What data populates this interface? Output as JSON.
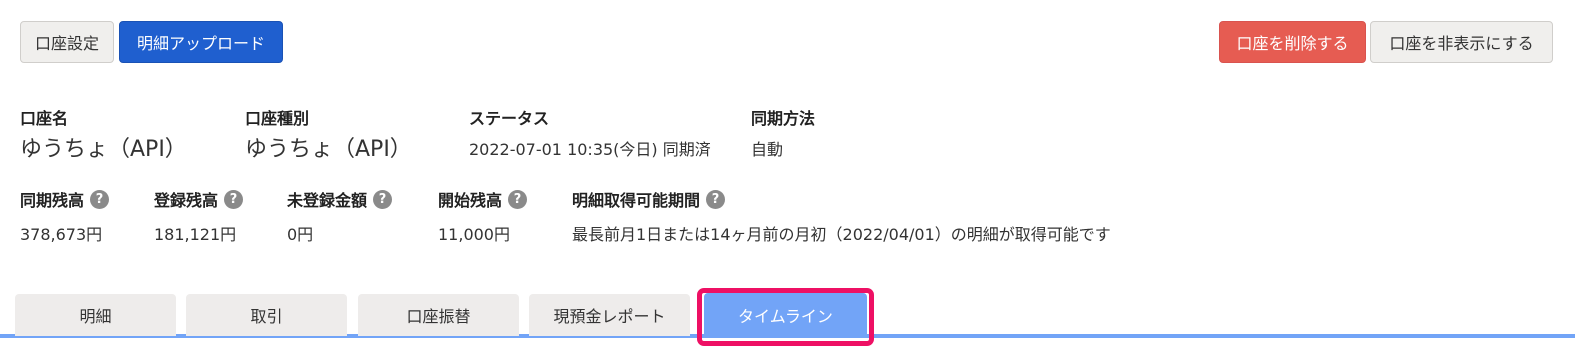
{
  "toolbar": {
    "account_settings_label": "口座設定",
    "upload_statement_label": "明細アップロード",
    "delete_account_label": "口座を削除する",
    "hide_account_label": "口座を非表示にする"
  },
  "account_info": {
    "name": {
      "label": "口座名",
      "value": "ゆうちょ（API）"
    },
    "type": {
      "label": "口座種別",
      "value": "ゆうちょ（API）"
    },
    "status": {
      "label": "ステータス",
      "value": "2022-07-01 10:35(今日) 同期済"
    },
    "sync_method": {
      "label": "同期方法",
      "value": "自動"
    }
  },
  "balances": {
    "synced_balance": {
      "label": "同期残高",
      "value": "378,673円",
      "help_icon": "question-circle"
    },
    "registered_balance": {
      "label": "登録残高",
      "value": "181,121円",
      "help_icon": "question-circle"
    },
    "unregistered_amount": {
      "label": "未登録金額",
      "value": "0円",
      "help_icon": "question-circle"
    },
    "opening_balance": {
      "label": "開始残高",
      "value": "11,000円",
      "help_icon": "question-circle"
    },
    "statement_period": {
      "label": "明細取得可能期間",
      "value": "最長前月1日または14ヶ月前の月初（2022/04/01）の明細が取得可能です",
      "help_icon": "question-circle"
    }
  },
  "help_icon_glyph": "?",
  "tabs": [
    {
      "label": "明細",
      "active": false
    },
    {
      "label": "取引",
      "active": false
    },
    {
      "label": "口座振替",
      "active": false
    },
    {
      "label": "現預金レポート",
      "active": false
    },
    {
      "label": "タイムライン",
      "active": true
    }
  ],
  "colors": {
    "primary_blue": "#1f5fcf",
    "danger_red": "#e65c52",
    "active_tab_blue": "#72a4f7",
    "highlight_pink": "#ee1064"
  }
}
